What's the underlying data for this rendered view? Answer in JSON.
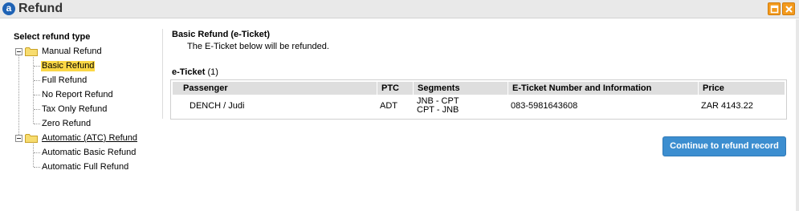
{
  "window": {
    "app_icon_letter": "a",
    "title": "Refund"
  },
  "tree": {
    "heading": "Select refund type",
    "groups": [
      {
        "label": "Manual Refund",
        "items": [
          {
            "label": "Basic Refund",
            "selected": true
          },
          {
            "label": "Full Refund"
          },
          {
            "label": "No Report Refund"
          },
          {
            "label": "Tax Only Refund"
          },
          {
            "label": "Zero Refund"
          }
        ]
      },
      {
        "label": "Automatic (ATC) Refund",
        "items": [
          {
            "label": "Automatic Basic Refund"
          },
          {
            "label": "Automatic Full Refund"
          }
        ]
      }
    ]
  },
  "content": {
    "title": "Basic Refund (e-Ticket)",
    "description": "The E-Ticket below will be refunded.",
    "eticket_label": "e-Ticket",
    "eticket_count": "(1)",
    "table": {
      "headers": [
        "Passenger",
        "PTC",
        "Segments",
        "E-Ticket Number and Information",
        "Price"
      ],
      "rows": [
        {
          "passenger": "DENCH / Judi",
          "ptc": "ADT",
          "segments": [
            "JNB - CPT",
            "CPT - JNB"
          ],
          "eticket_number": "083-5981643608",
          "price": "ZAR 4143.22"
        }
      ]
    },
    "continue_button": "Continue to refund record"
  },
  "colors": {
    "accent_button": "#3c8ed0",
    "selection_highlight": "#fbd745",
    "window_controls": "#f39a1d",
    "app_icon": "#1f63b5"
  },
  "icons": {
    "app": "amadeus-logo-icon",
    "maximize": "maximize-icon",
    "close": "close-icon",
    "folder": "folder-icon",
    "collapse": "collapse-minus-icon"
  }
}
